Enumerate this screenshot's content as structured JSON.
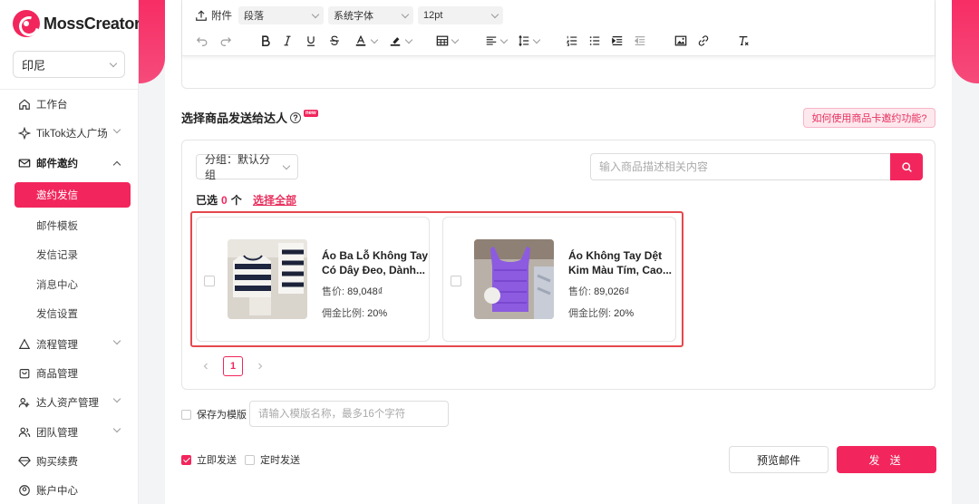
{
  "app": {
    "name": "MossCreator",
    "region": "印尼"
  },
  "nav": {
    "workbench": "工作台",
    "tiktok_plaza": "TikTok达人广场",
    "mail_invite": "邮件邀约",
    "invite_send": "邀约发信",
    "mail_template": "邮件模板",
    "send_record": "发信记录",
    "message_center": "消息中心",
    "send_settings": "发信设置",
    "flow_mgmt": "流程管理",
    "product_mgmt": "商品管理",
    "creator_assets": "达人资产管理",
    "team_mgmt": "团队管理",
    "buy_renew": "购买续费",
    "account_center": "账户中心"
  },
  "toolbar": {
    "attach": "附件",
    "paragraph": "段落",
    "font": "系统字体",
    "size": "12pt"
  },
  "section": {
    "title": "选择商品发送给达人",
    "new_badge": "new",
    "howto": "如何使用商品卡邀约功能?"
  },
  "filter": {
    "group_label": "分组：默认分组",
    "search_placeholder": "输入商品描述相关内容"
  },
  "selection": {
    "prefix": "已选",
    "count": "0",
    "unit": "个",
    "select_all": "选择全部"
  },
  "products": [
    {
      "title1": "Áo Ba Lỗ Không Tay",
      "title2": "Có Dây Đeo, Dành...",
      "price_label": "售价:",
      "price": "89,048₫",
      "comm_label": "佣金比例:",
      "comm": "20%"
    },
    {
      "title1": "Áo Không Tay Dệt",
      "title2": "Kim Màu Tím, Cao...",
      "price_label": "售价:",
      "price": "89,026₫",
      "comm_label": "佣金比例:",
      "comm": "20%"
    }
  ],
  "pager": {
    "current": "1"
  },
  "template": {
    "save_label": "保存为模版",
    "name_placeholder": "请输入模版名称，最多16个字符"
  },
  "send": {
    "immediate": "立即发送",
    "scheduled": "定时发送",
    "preview": "预览邮件",
    "send": "发 送"
  },
  "colors": {
    "accent": "#f2265c",
    "highlight_border": "#e5484d"
  }
}
